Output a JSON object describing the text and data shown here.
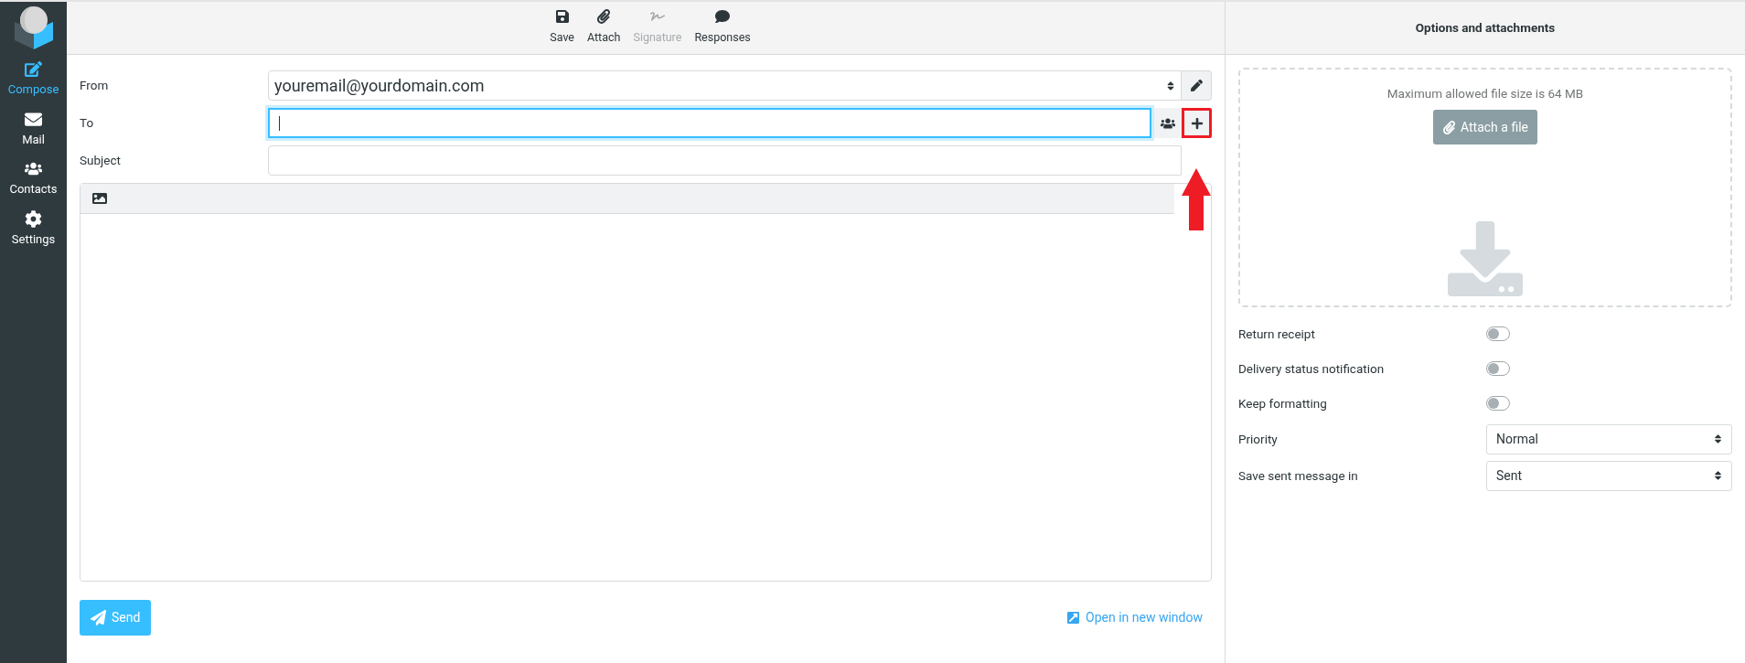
{
  "sidebar": {
    "items": [
      {
        "kind": "compose",
        "label": "Compose",
        "selected": true
      },
      {
        "kind": "mail",
        "label": "Mail",
        "selected": false
      },
      {
        "kind": "contacts",
        "label": "Contacts",
        "selected": false
      },
      {
        "kind": "settings",
        "label": "Settings",
        "selected": false
      }
    ]
  },
  "toolbar": {
    "items": [
      {
        "kind": "save",
        "label": "Save",
        "disabled": false
      },
      {
        "kind": "attach",
        "label": "Attach",
        "disabled": false
      },
      {
        "kind": "signature",
        "label": "Signature",
        "disabled": true
      },
      {
        "kind": "responses",
        "label": "Responses",
        "disabled": false
      }
    ]
  },
  "form": {
    "from": {
      "label": "From",
      "value": "youremail@yourdomain.com"
    },
    "to": {
      "label": "To"
    },
    "subject": {
      "label": "Subject"
    }
  },
  "highlight": {
    "on": true
  },
  "send_button": "Send",
  "open_new_window_link": "Open in new window",
  "options_panel": {
    "title": "Options and attachments",
    "max_size_note": "Maximum allowed file size is 64 MB",
    "attach_button": "Attach a file",
    "toggles": [
      {
        "label": "Return receipt",
        "on": false
      },
      {
        "label": "Delivery status notification",
        "on": false
      },
      {
        "label": "Keep formatting",
        "on": false
      }
    ],
    "selects": [
      {
        "label": "Priority",
        "value": "Normal"
      },
      {
        "label": "Save sent message in",
        "value": "Sent"
      }
    ]
  }
}
